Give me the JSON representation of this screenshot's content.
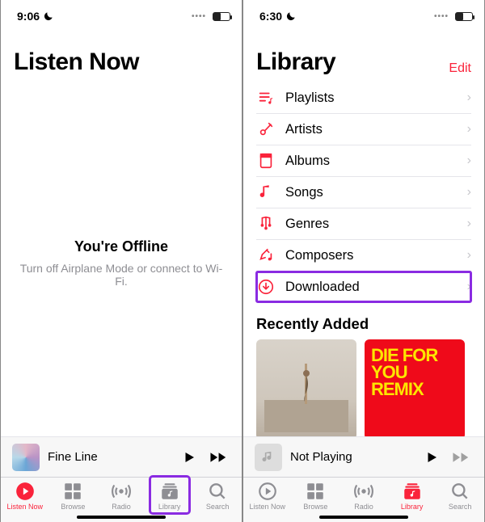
{
  "left": {
    "status_time": "9:06",
    "title": "Listen Now",
    "offline": {
      "heading": "You're Offline",
      "subtext": "Turn off Airplane Mode or connect to Wi-Fi."
    },
    "now_playing": {
      "track": "Fine Line"
    },
    "tabs": [
      {
        "label": "Listen Now",
        "icon": "play-circle-icon",
        "active": true
      },
      {
        "label": "Browse",
        "icon": "browse-icon"
      },
      {
        "label": "Radio",
        "icon": "radio-icon"
      },
      {
        "label": "Library",
        "icon": "library-icon",
        "highlight": true
      },
      {
        "label": "Search",
        "icon": "search-icon"
      }
    ]
  },
  "right": {
    "status_time": "6:30",
    "title": "Library",
    "edit_label": "Edit",
    "rows": [
      {
        "icon": "playlists-icon",
        "label": "Playlists"
      },
      {
        "icon": "artists-icon",
        "label": "Artists"
      },
      {
        "icon": "albums-icon",
        "label": "Albums"
      },
      {
        "icon": "songs-icon",
        "label": "Songs"
      },
      {
        "icon": "genres-icon",
        "label": "Genres"
      },
      {
        "icon": "composers-icon",
        "label": "Composers"
      },
      {
        "icon": "downloaded-icon",
        "label": "Downloaded",
        "highlight": true
      }
    ],
    "section_heading": "Recently Added",
    "albums": [
      {
        "title_lines": [
          "",
          "",
          ""
        ]
      },
      {
        "title_lines": [
          "DIE FOR",
          "YOU",
          "REMIX"
        ]
      }
    ],
    "now_playing": {
      "track": "Not Playing"
    },
    "tabs": [
      {
        "label": "Listen Now",
        "icon": "play-circle-icon"
      },
      {
        "label": "Browse",
        "icon": "browse-icon"
      },
      {
        "label": "Radio",
        "icon": "radio-icon"
      },
      {
        "label": "Library",
        "icon": "library-icon",
        "active": true
      },
      {
        "label": "Search",
        "icon": "search-icon"
      }
    ]
  }
}
